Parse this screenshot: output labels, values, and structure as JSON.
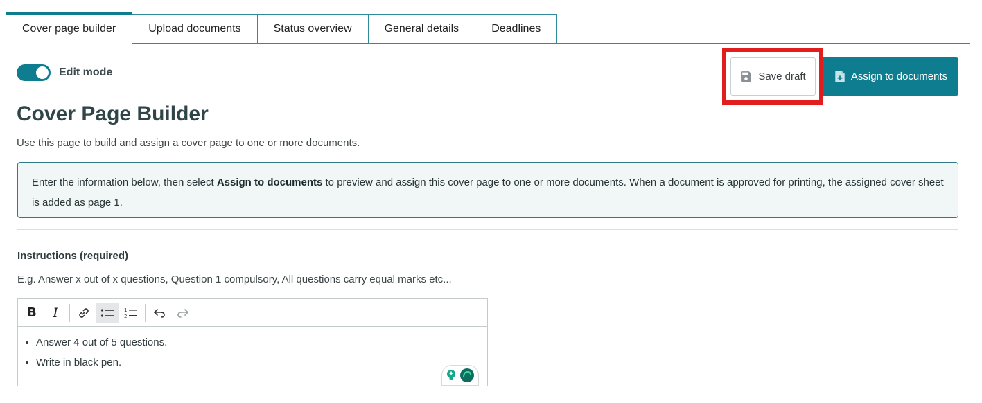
{
  "tabs": [
    {
      "label": "Cover page builder",
      "active": true
    },
    {
      "label": "Upload documents",
      "active": false
    },
    {
      "label": "Status overview",
      "active": false
    },
    {
      "label": "General details",
      "active": false
    },
    {
      "label": "Deadlines",
      "active": false
    }
  ],
  "edit_mode": {
    "label": "Edit mode",
    "enabled": true
  },
  "actions": {
    "save_draft": "Save draft",
    "assign": "Assign to documents"
  },
  "header": {
    "title": "Cover Page Builder",
    "description": "Use this page to build and assign a cover page to one or more documents."
  },
  "info": {
    "before": "Enter the information below, then select ",
    "bold": "Assign to documents",
    "after": " to preview and assign this cover page to one or more documents. When a document is approved for printing, the assigned cover sheet is added as page 1."
  },
  "instructions": {
    "label": "Instructions (required)",
    "hint": "E.g. Answer x out of x questions, Question 1 compulsory, All questions carry equal marks etc...",
    "items": [
      "Answer 4 out of 5 questions.",
      "Write in black pen."
    ]
  },
  "colors": {
    "accent": "#0e7d8f",
    "highlight": "#e11d1d"
  }
}
